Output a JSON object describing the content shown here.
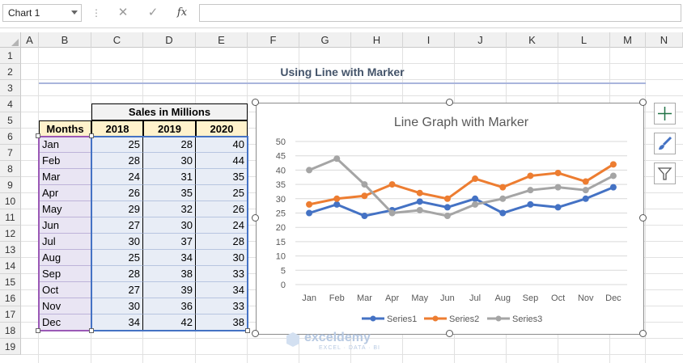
{
  "formula_bar": {
    "name_box": "Chart 1",
    "cancel_icon": "✕",
    "enter_icon": "✓",
    "fx_label": "fx",
    "formula": ""
  },
  "columns": [
    "A",
    "B",
    "C",
    "D",
    "E",
    "F",
    "G",
    "H",
    "I",
    "J",
    "K",
    "L",
    "M",
    "N"
  ],
  "rows": [
    "1",
    "2",
    "3",
    "4",
    "5",
    "6",
    "7",
    "8",
    "9",
    "10",
    "11",
    "12",
    "13",
    "14",
    "15",
    "16",
    "17",
    "18",
    "19"
  ],
  "heading": "Using Line with Marker",
  "table": {
    "group_header": "Sales in Millions",
    "month_header": "Months",
    "year_headers": [
      "2018",
      "2019",
      "2020"
    ],
    "rows": [
      {
        "month": "Jan",
        "v": [
          "25",
          "28",
          "40"
        ]
      },
      {
        "month": "Feb",
        "v": [
          "28",
          "30",
          "44"
        ]
      },
      {
        "month": "Mar",
        "v": [
          "24",
          "31",
          "35"
        ]
      },
      {
        "month": "Apr",
        "v": [
          "26",
          "35",
          "25"
        ]
      },
      {
        "month": "May",
        "v": [
          "29",
          "32",
          "26"
        ]
      },
      {
        "month": "Jun",
        "v": [
          "27",
          "30",
          "24"
        ]
      },
      {
        "month": "Jul",
        "v": [
          "30",
          "37",
          "28"
        ]
      },
      {
        "month": "Aug",
        "v": [
          "25",
          "34",
          "30"
        ]
      },
      {
        "month": "Sep",
        "v": [
          "28",
          "38",
          "33"
        ]
      },
      {
        "month": "Oct",
        "v": [
          "27",
          "39",
          "34"
        ]
      },
      {
        "month": "Nov",
        "v": [
          "30",
          "36",
          "33"
        ]
      },
      {
        "month": "Dec",
        "v": [
          "34",
          "42",
          "38"
        ]
      }
    ]
  },
  "chart_data": {
    "type": "line",
    "title": "Line Graph with Marker",
    "categories": [
      "Jan",
      "Feb",
      "Mar",
      "Apr",
      "May",
      "Jun",
      "Jul",
      "Aug",
      "Sep",
      "Oct",
      "Nov",
      "Dec"
    ],
    "ylim": [
      0,
      50
    ],
    "yticks": [
      0,
      5,
      10,
      15,
      20,
      25,
      30,
      35,
      40,
      45,
      50
    ],
    "grid": true,
    "legend": "bottom",
    "series": [
      {
        "name": "Series1",
        "color": "#4472c4",
        "values": [
          25,
          28,
          24,
          26,
          29,
          27,
          30,
          25,
          28,
          27,
          30,
          34
        ]
      },
      {
        "name": "Series2",
        "color": "#ed7d31",
        "values": [
          28,
          30,
          31,
          35,
          32,
          30,
          37,
          34,
          38,
          39,
          36,
          42
        ]
      },
      {
        "name": "Series3",
        "color": "#a5a5a5",
        "values": [
          40,
          44,
          35,
          25,
          26,
          24,
          28,
          30,
          33,
          34,
          33,
          38
        ]
      }
    ]
  },
  "side_buttons": [
    "chart-elements-icon",
    "chart-styles-icon",
    "chart-filters-icon"
  ],
  "watermark": {
    "name": "exceldemy",
    "tagline": "EXCEL · DATA · BI"
  },
  "colors": {
    "accent": "#217346",
    "heading": "#44546a"
  }
}
